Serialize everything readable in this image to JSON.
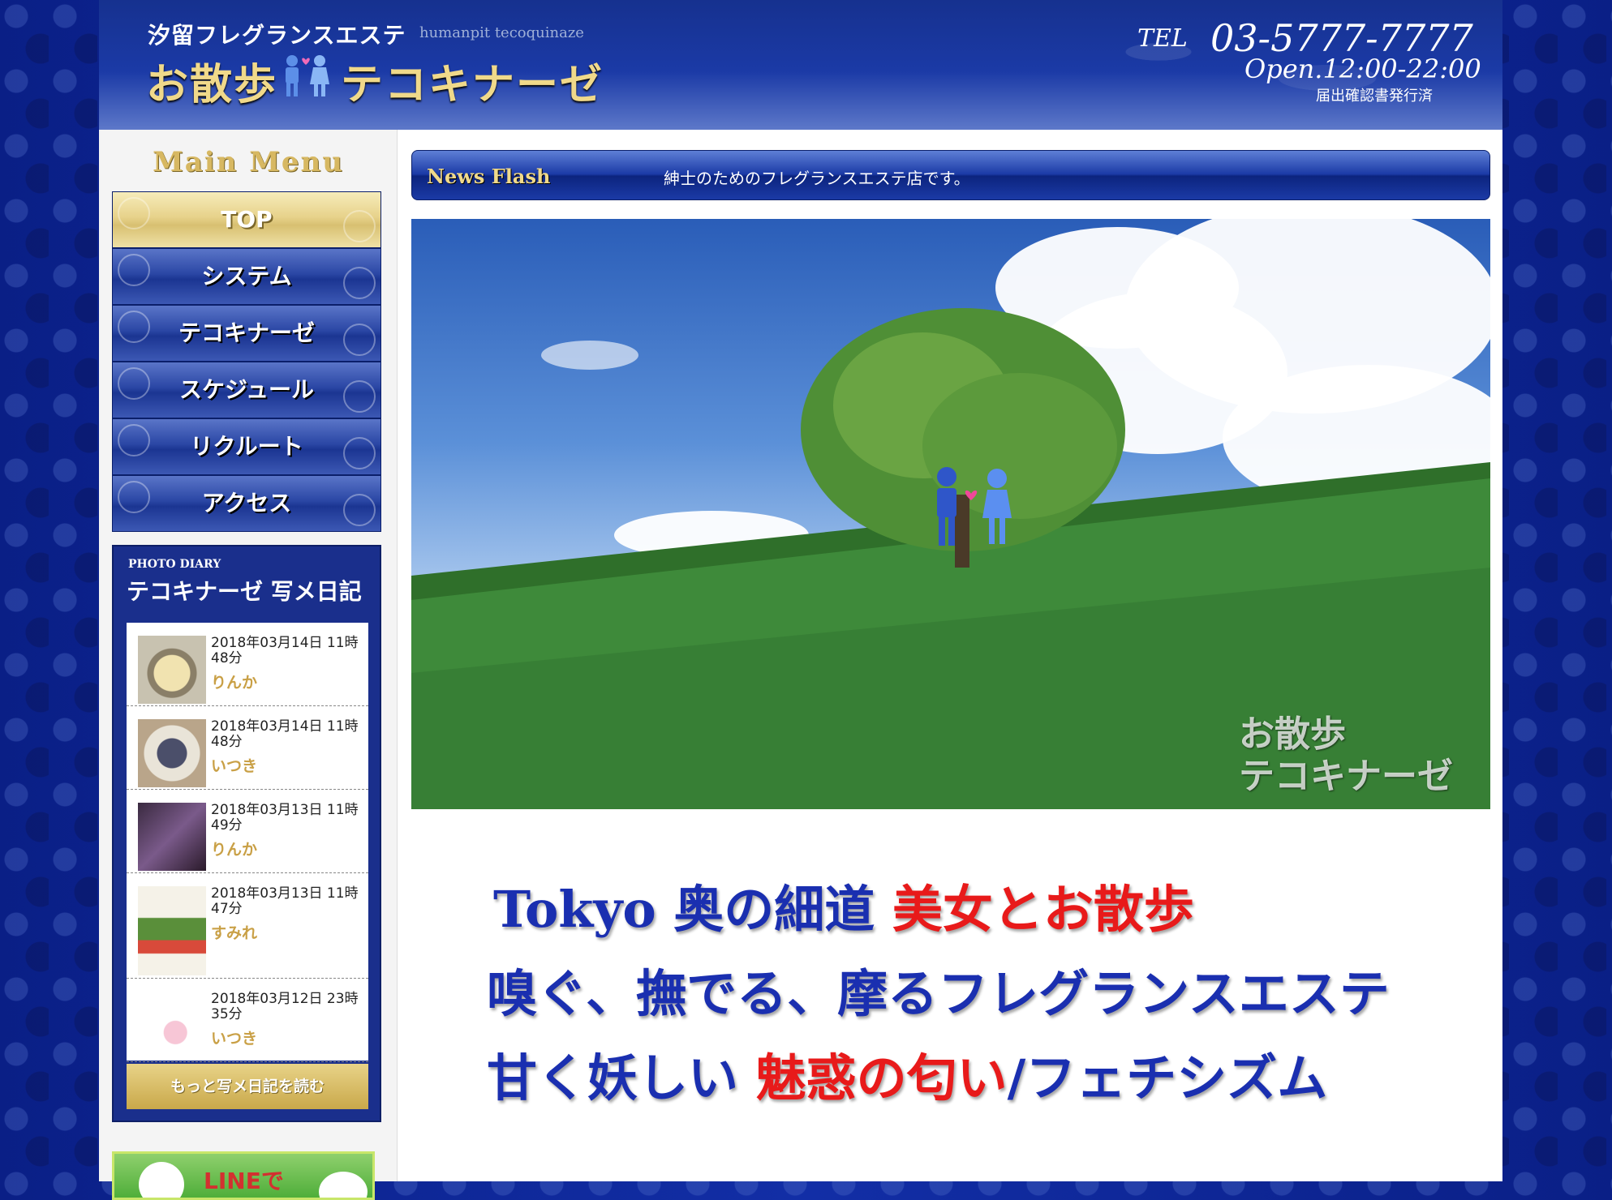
{
  "header": {
    "brand_top": "汐留フレグランスエステ",
    "brand_roman": "humanpit tecoquinaze",
    "brand_name_a": "お散歩",
    "brand_name_b": "テコキナーゼ",
    "tel_label": "TEL",
    "tel_number": "03-5777-7777",
    "open_hours": "Open.12:00-22:00",
    "license": "届出確認書発行済"
  },
  "sidebar": {
    "menu_title": "Main Menu",
    "menu": [
      {
        "label": "TOP"
      },
      {
        "label": "システム"
      },
      {
        "label": "テコキナーゼ"
      },
      {
        "label": "スケジュール"
      },
      {
        "label": "リクルート"
      },
      {
        "label": "アクセス"
      }
    ],
    "diary": {
      "subtitle": "PHOTO DIARY",
      "title": "テコキナーゼ 写メ日記",
      "entries": [
        {
          "date": "2018年03月14日 11時48分",
          "author": "りんか"
        },
        {
          "date": "2018年03月14日 11時48分",
          "author": "いつき"
        },
        {
          "date": "2018年03月13日 11時49分",
          "author": "りんか"
        },
        {
          "date": "2018年03月13日 11時47分",
          "author": "すみれ"
        },
        {
          "date": "2018年03月12日 23時35分",
          "author": "いつき"
        }
      ],
      "more_label": "もっと写メ日記を読む"
    },
    "line_banner": {
      "text": "LINEで"
    }
  },
  "main": {
    "news_label": "News Flash",
    "news_text": "紳士のためのフレグランスエステ店です。",
    "hero_watermark_a": "お散歩",
    "hero_watermark_b": "テコキナーゼ",
    "slogan1_a": "Tokyo 奥の細道",
    "slogan1_b": "美女とお散歩",
    "slogan2": "嗅ぐ、撫でる、摩るフレグランスエステ",
    "slogan3_a": "甘く妖しい",
    "slogan3_b": "魅惑の匂い",
    "slogan3_c": "/フェチシズム"
  },
  "colors": {
    "brand_blue": "#1b3aa6",
    "gold": "#f0d98a",
    "slogan_blue": "#1a2fb0",
    "slogan_red": "#e81a1a",
    "diary_author": "#c9a046"
  },
  "icons": [
    "couple-figures-icon",
    "heart-icon",
    "line-logo-icon",
    "bunny-icon"
  ]
}
